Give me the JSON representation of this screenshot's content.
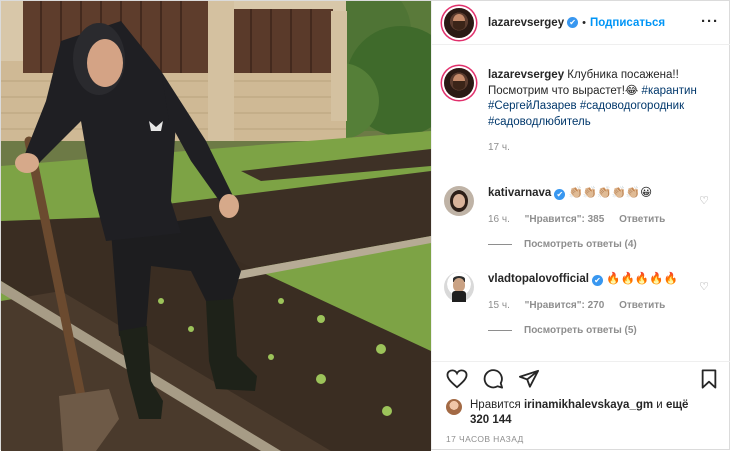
{
  "header": {
    "username": "lazarevsergey",
    "verified_mark": "✔",
    "separator": "•",
    "follow_label": "Подписаться",
    "more_label": "···"
  },
  "caption": {
    "username": "lazarevsergey",
    "text": "Клубника посажена!! Посмотрим что вырастет!😂",
    "hashtags": [
      "#карантин",
      "#СергейЛазарев",
      "#садоводогородник",
      "#садоводлюбитель"
    ],
    "time": "17 ч."
  },
  "comments": [
    {
      "username": "kativarnava",
      "text": "👏🏼👏🏼👏🏼👏🏼👏🏼😀",
      "time": "16 ч.",
      "likes": "\"Нравится\": 385",
      "reply_label": "Ответить",
      "view_replies": "Посмотреть ответы (4)"
    },
    {
      "username": "vladtopalovofficial",
      "text": "🔥🔥🔥🔥🔥",
      "time": "15 ч.",
      "likes": "\"Нравится\": 270",
      "reply_label": "Ответить",
      "view_replies": "Посмотреть ответы (5)"
    }
  ],
  "actions": {
    "icons": [
      "heart-icon",
      "comment-icon",
      "share-icon",
      "bookmark-icon"
    ]
  },
  "likes": {
    "prefix": "Нравится",
    "user": "irinamikhalevskaya_gm",
    "suffix": "и",
    "others": "ещё 320 144"
  },
  "date": "17 ЧАСОВ НАЗАД",
  "colors": {
    "link": "#0095f6",
    "hashtag": "#00376b",
    "muted": "#8e8e8e",
    "verified": "#3897f0"
  }
}
